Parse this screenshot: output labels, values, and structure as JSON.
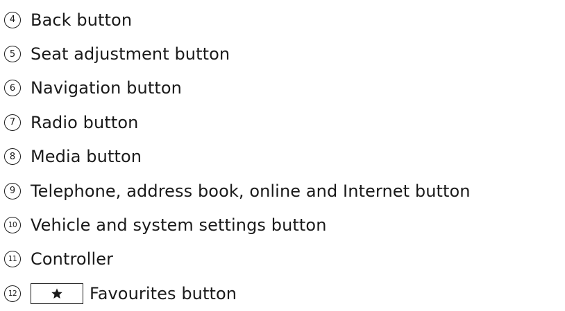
{
  "items": [
    {
      "number": "4",
      "label": "Back button"
    },
    {
      "number": "5",
      "label": "Seat adjustment button"
    },
    {
      "number": "6",
      "label": "Navigation button"
    },
    {
      "number": "7",
      "label": "Radio button"
    },
    {
      "number": "8",
      "label": "Media button"
    },
    {
      "number": "9",
      "label": "Telephone, address book, online and Internet button"
    },
    {
      "number": "10",
      "label": "Vehicle and system settings button"
    },
    {
      "number": "11",
      "label": "Controller"
    },
    {
      "number": "12",
      "label": "Favourites button",
      "key_icon": "star-icon"
    }
  ]
}
